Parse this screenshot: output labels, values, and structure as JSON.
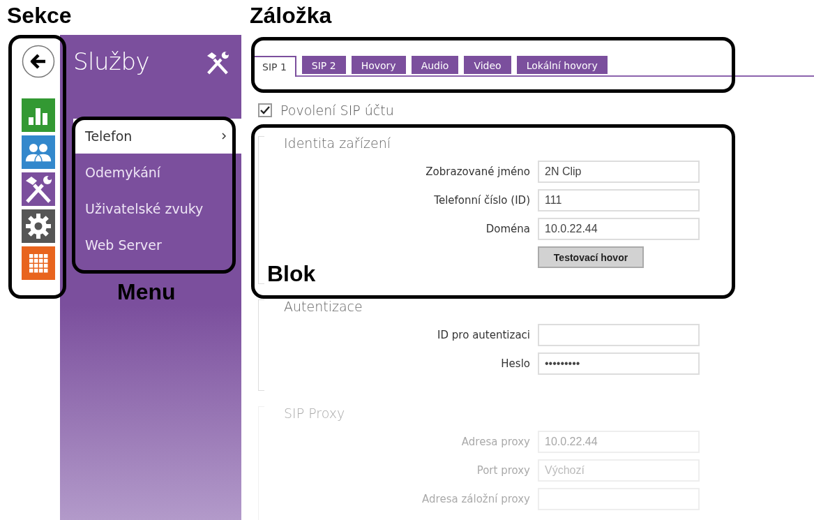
{
  "annotations": [
    {
      "label": "Sekce"
    },
    {
      "label": "Záložka"
    },
    {
      "label": "Menu"
    },
    {
      "label": "Blok"
    }
  ],
  "sections": [
    {
      "kind": "back"
    },
    {
      "kind": "chart"
    },
    {
      "kind": "users"
    },
    {
      "kind": "tools"
    },
    {
      "kind": "gear"
    },
    {
      "kind": "grid"
    }
  ],
  "panel": {
    "title": "Služby"
  },
  "menu": [
    {
      "label": "Telefon",
      "selected": true
    },
    {
      "label": "Odemykání",
      "selected": false
    },
    {
      "label": "Uživatelské zvuky",
      "selected": false
    },
    {
      "label": "Web Server",
      "selected": false
    }
  ],
  "tabs": [
    {
      "label": "SIP 1",
      "selected": true
    },
    {
      "label": "SIP 2",
      "selected": false
    },
    {
      "label": "Hovory",
      "selected": false
    },
    {
      "label": "Audio",
      "selected": false
    },
    {
      "label": "Video",
      "selected": false
    },
    {
      "label": "Lokální hovory",
      "selected": false
    }
  ],
  "enable_checkbox": {
    "label": "Povolení SIP účtu",
    "checked": true
  },
  "blocks": [
    {
      "title": "Identita zařízení",
      "disabled": false,
      "fields": [
        {
          "label": "Zobrazované jméno",
          "value": "2N Clip"
        },
        {
          "label": "Telefonní číslo (ID)",
          "value": "111"
        },
        {
          "label": "Doména",
          "value": "10.0.22.44"
        }
      ],
      "button": "Testovací hovor"
    },
    {
      "title": "Autentizace",
      "disabled": false,
      "fields": [
        {
          "label": "ID pro autentizaci"
        },
        {
          "label": "Heslo",
          "value": "•••••••••"
        }
      ]
    },
    {
      "title": "SIP Proxy",
      "disabled": true,
      "fields": [
        {
          "label": "Adresa proxy",
          "value": "10.0.22.44"
        },
        {
          "label": "Port proxy",
          "placeholder": "Výchozí"
        },
        {
          "label": "Adresa záložní proxy"
        }
      ]
    }
  ]
}
